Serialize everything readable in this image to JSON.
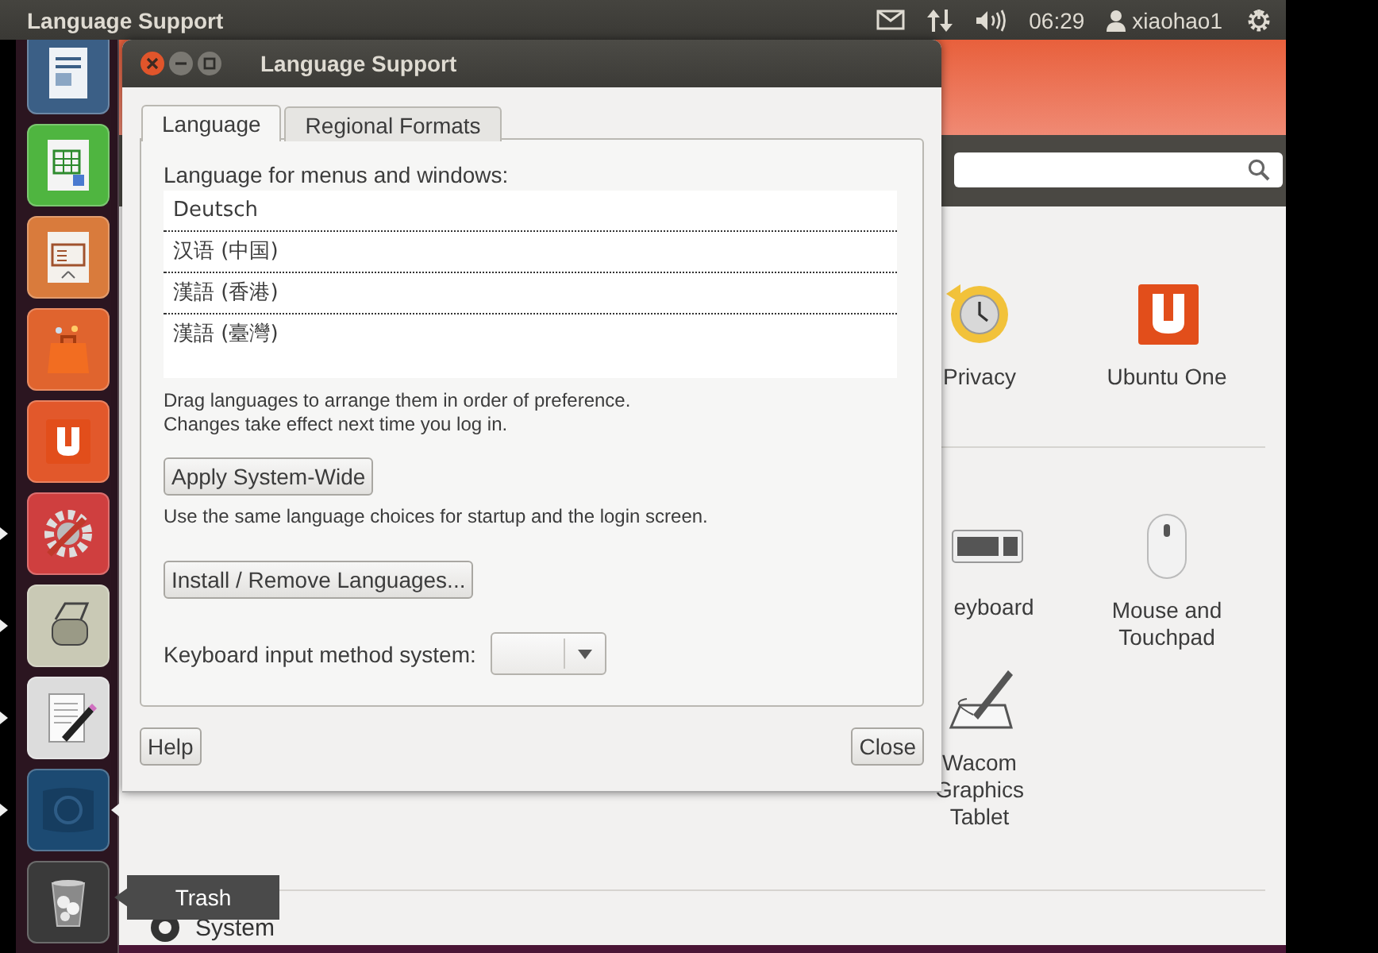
{
  "top_panel": {
    "title": "Language Support",
    "clock": "06:29",
    "user": "xiaohao1"
  },
  "launcher": [
    {
      "kind": "document",
      "running": false,
      "active": false
    },
    {
      "kind": "spreadsheet",
      "running": false,
      "active": false
    },
    {
      "kind": "presentation",
      "running": false,
      "active": false
    },
    {
      "kind": "bag",
      "running": false,
      "active": false
    },
    {
      "kind": "u-logo",
      "running": false,
      "active": false
    },
    {
      "kind": "settings",
      "running": true,
      "active": false
    },
    {
      "kind": "roller",
      "running": true,
      "active": false
    },
    {
      "kind": "editor",
      "running": true,
      "active": false
    },
    {
      "kind": "flag",
      "running": true,
      "active": true
    },
    {
      "kind": "trash",
      "running": false,
      "active": false
    }
  ],
  "trash_tooltip": "Trash",
  "settings_window": {
    "sections": [
      {
        "items": [
          {
            "kind": "privacy",
            "label": "Privacy"
          },
          {
            "kind": "ubuntu-one",
            "label": "Ubuntu One"
          }
        ]
      },
      {
        "items": [
          {
            "kind": "keyboard",
            "label": "eyboard"
          },
          {
            "kind": "mouse",
            "label": "Mouse and Touchpad"
          },
          {
            "kind": "wacom",
            "label": "Wacom Graphics Tablet"
          }
        ]
      }
    ],
    "bottom_section": "System"
  },
  "dialog": {
    "title": "Language Support",
    "tabs": [
      {
        "label": "Language",
        "selected": true
      },
      {
        "label": "Regional Formats",
        "selected": false
      }
    ],
    "list_label": "Language for menus and windows:",
    "languages": [
      "Deutsch",
      "汉语 (中国)",
      "漢語 (香港)",
      "漢語 (臺灣)"
    ],
    "hints": [
      "Drag languages to arrange them in order of preference.",
      "Changes take effect next time you log in."
    ],
    "apply_button": "Apply System-Wide",
    "apply_note": "Use the same language choices for startup and the login screen.",
    "install_button": "Install / Remove Languages...",
    "input_method_label": "Keyboard input method system:",
    "help_button": "Help",
    "close_button": "Close"
  }
}
